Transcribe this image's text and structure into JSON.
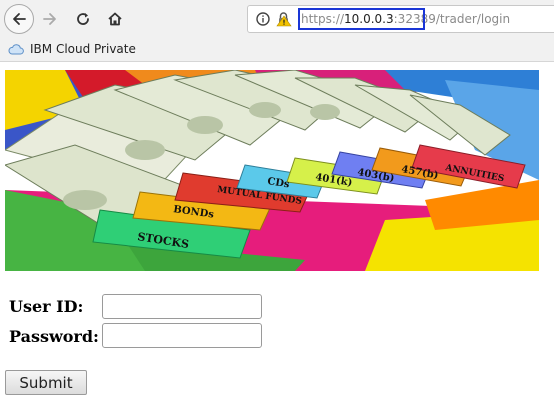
{
  "browser": {
    "url_scheme": "https://",
    "url_host": "10.0.0.3",
    "url_port": ":32389",
    "url_path": "/trader/login",
    "bookmarks": [
      {
        "label": "IBM Cloud Private",
        "icon": "cloud-icon"
      }
    ]
  },
  "banner": {
    "folder_labels": [
      "STOCKS",
      "BONDs",
      "MUTUAL FUNDS",
      "CDs",
      "401(k)",
      "403(b)",
      "457(b)",
      "ANNUITIES"
    ]
  },
  "form": {
    "userid_label": "User ID:",
    "password_label": "Password:",
    "userid_value": "",
    "password_value": "",
    "submit_label": "Submit"
  }
}
